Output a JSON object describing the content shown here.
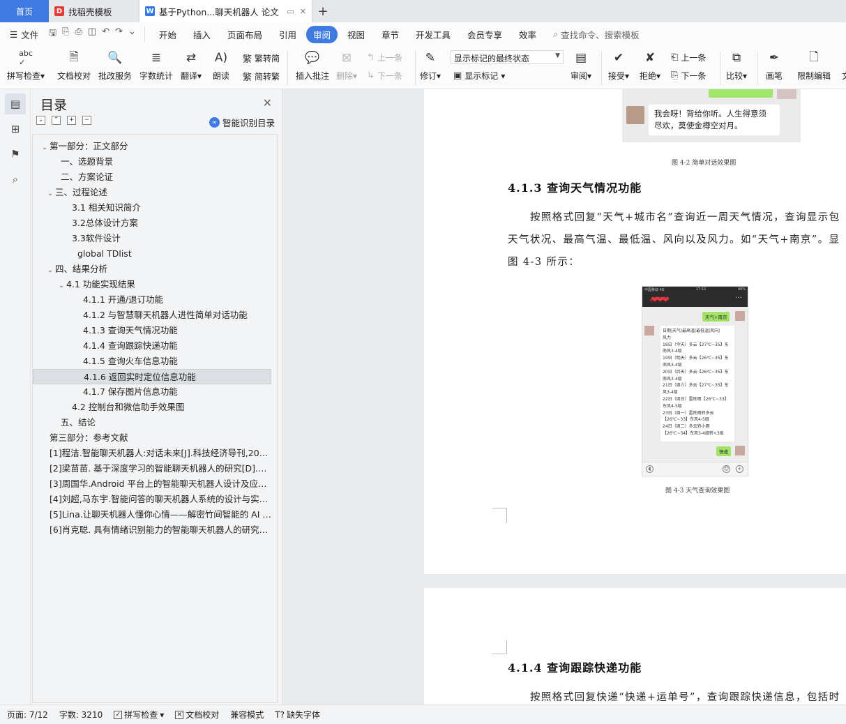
{
  "tabs": {
    "home": "首页",
    "tab1": "找稻壳模板",
    "tab2": "基于Python...聊天机器人 论文",
    "add": "+"
  },
  "menu": {
    "file": "文件",
    "items": [
      "开始",
      "插入",
      "页面布局",
      "引用",
      "审阅",
      "视图",
      "章节",
      "开发工具",
      "会员专享",
      "效率"
    ],
    "active_index": 4,
    "search_placeholder": "查找命令、搜索模板"
  },
  "ribbon": {
    "spell_check": "拼写检查",
    "doc_proof": "文档校对",
    "batch_service": "批改服务",
    "word_count": "字数统计",
    "translate": "翻译",
    "read_aloud": "朗读",
    "trad_to_simp": "繁转简",
    "simp_to_trad": "简转繁",
    "insert_comment": "插入批注",
    "delete": "删除",
    "prev": "上一条",
    "next": "下一条",
    "revise": "修订",
    "markup_select": "显示标记的最终状态",
    "show_markup": "显示标记",
    "review": "审阅",
    "accept": "接受",
    "reject": "拒绝",
    "prev2": "上一条",
    "next2": "下一条",
    "compare": "比较",
    "pen": "画笔",
    "restrict_edit": "限制编辑",
    "doc_perm": "文"
  },
  "toc": {
    "title": "目录",
    "smart": "智能识别目录",
    "items": [
      {
        "label": "第一部分：正文部分",
        "level": 0,
        "toggle": "v"
      },
      {
        "label": "一、选题背景",
        "level": 1,
        "toggle": ""
      },
      {
        "label": "二、方案论证",
        "level": 1,
        "toggle": ""
      },
      {
        "label": "三、过程论述",
        "level": 0.5,
        "toggle": "v"
      },
      {
        "label": "3.1  相关知识简介",
        "level": 2,
        "toggle": ""
      },
      {
        "label": "3.2总体设计方案",
        "level": 2,
        "toggle": ""
      },
      {
        "label": "3.3软件设计",
        "level": 2,
        "toggle": ""
      },
      {
        "label": "global TDlist",
        "level": 2.5,
        "toggle": ""
      },
      {
        "label": "四、结果分析",
        "level": 0.5,
        "toggle": "v"
      },
      {
        "label": "4.1  功能实现结果",
        "level": 1.5,
        "toggle": "v"
      },
      {
        "label": "4.1.1  开通/退订功能",
        "level": 3,
        "toggle": ""
      },
      {
        "label": "4.1.2  与智慧聊天机器人进性简单对话功能",
        "level": 3,
        "toggle": ""
      },
      {
        "label": "4.1.3  查询天气情况功能",
        "level": 3,
        "toggle": ""
      },
      {
        "label": "4.1.4  查询跟踪快递功能",
        "level": 3,
        "toggle": ""
      },
      {
        "label": "4.1.5  查询火车信息功能",
        "level": 3,
        "toggle": ""
      },
      {
        "label": "4.1.6  返回实时定位信息功能",
        "level": 3,
        "toggle": "",
        "selected": true
      },
      {
        "label": "4.1.7 保存图片信息功能",
        "level": 3,
        "toggle": ""
      },
      {
        "label": "4.2  控制台和微信助手效果图",
        "level": 2,
        "toggle": ""
      },
      {
        "label": "五、结论",
        "level": 1,
        "toggle": ""
      },
      {
        "label": "第三部分：参考文献",
        "level": 0,
        "toggle": ""
      },
      {
        "label": "[1]程洁.智能聊天机器人:对话未来[J].科技经济导刊,2016(33):15.",
        "level": 0,
        "toggle": ""
      },
      {
        "label": "[2]梁苗苗. 基于深度学习的智能聊天机器人的研究[D].浙江理工大学,2018.",
        "level": 0,
        "toggle": ""
      },
      {
        "label": "[3]周国华.Android 平台上的智能聊天机器人设计及应用[D].",
        "level": 0,
        "toggle": ""
      },
      {
        "label": "[4]刘超,马东宇.智能问答的聊天机器人系统的设计与实现[J].",
        "level": 0,
        "toggle": ""
      },
      {
        "label": "[5]Lina.让聊天机器人懂你心情——解密竹间智能的 AI 技术",
        "level": 0,
        "toggle": ""
      },
      {
        "label": "[6]肖克聪. 具有情绪识别能力的智能聊天机器人的研究[D].",
        "level": 0,
        "toggle": ""
      }
    ]
  },
  "doc": {
    "chat_reply": "我会呀！背给你听。人生得意须尽欢，莫使金樽空对月。",
    "caption_42": "图 4-2  简单对话效果图",
    "heading_413": "4.1.3 查询天气情况功能",
    "para_413_l1": "按照格式回复“天气+城市名”查询近一周天气情况，查询显示包",
    "para_413_l2": "天气状况、最高气温、最低温、风向以及风力。如“天气+南京”。显",
    "para_413_l3": "图 4-3 所示：",
    "caption_43": "图 4-3  天气查询效果图",
    "heading_414": "4.1.4 查询跟踪快递功能",
    "para_414_l1": "按照格式回复快递“快递+运单号”，查询跟踪快递信息，包括时",
    "phone": {
      "status_left": "中国移动 4G",
      "status_time": "17:11",
      "status_right": "40%",
      "msg_weather": "天气+南京",
      "reply": "日期|天气|最高温|最低温|风向|\n风力\n18日（今天）多云【27℃~35】东\n南风3-4级\n19日（明天）多云【26℃~35】东\n南风3-4级\n20日（后天）多云【26℃~35】东\n南风3-4级\n21日（周六）多云【27℃~35】东\n风3-4级\n22日（周日）雷阵雨【26℃~33】\n东风4-5级\n23日（周一）雷阵雨转多云\n【26℃~33】东风4-5级\n24日（周二）多云转小雨\n【26℃~34】东风3-4级转<3级",
      "msg_express": "快递"
    }
  },
  "status": {
    "page": "页面: 7/12",
    "words": "字数: 3210",
    "spell": "拼写检查",
    "proof": "文档校对",
    "compat": "兼容模式",
    "missing_font": "缺失字体"
  },
  "colors": {
    "accent": "#3f7ae0",
    "wechat_green": "#a1e467"
  }
}
